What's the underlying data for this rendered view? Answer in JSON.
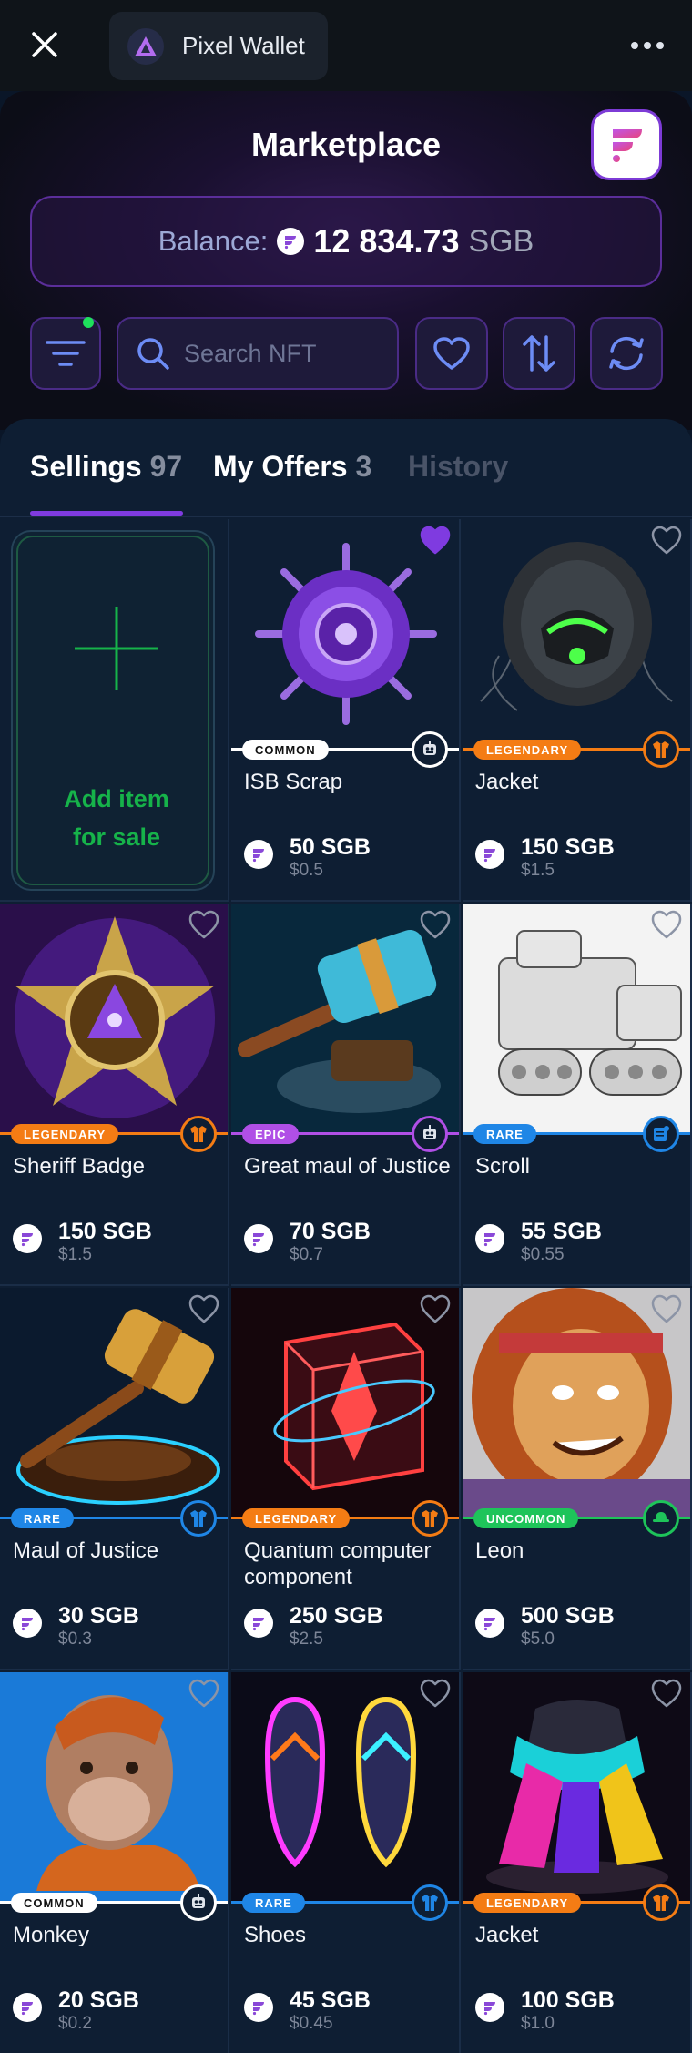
{
  "topbar": {
    "wallet_name": "Pixel Wallet"
  },
  "header": {
    "title": "Marketplace",
    "balance_label": "Balance:",
    "balance_amount": "12 834.73",
    "balance_unit": "SGB"
  },
  "search": {
    "placeholder": "Search NFT"
  },
  "tabs": [
    {
      "label": "Sellings",
      "count": "97",
      "active": true
    },
    {
      "label": "My Offers",
      "count": "3",
      "active": false
    },
    {
      "label": "History",
      "count": "",
      "active": false
    }
  ],
  "add_item": {
    "line1": "Add item",
    "line2": "for sale"
  },
  "colors": {
    "common": "#ffffff",
    "legendary": "#f47c14",
    "epic": "#b04fe6",
    "rare": "#1f86e6",
    "uncommon": "#1ec45a",
    "accent": "#7f3be0"
  },
  "items": [
    {
      "name": "ISB Scrap",
      "rarity": "COMMON",
      "price": "50 SGB",
      "usd": "$0.5",
      "liked": true,
      "icon": "robot-icon"
    },
    {
      "name": "Jacket",
      "rarity": "LEGENDARY",
      "price": "150 SGB",
      "usd": "$1.5",
      "liked": false,
      "icon": "jacket-icon"
    },
    {
      "name": "Sheriff Badge",
      "rarity": "LEGENDARY",
      "price": "150 SGB",
      "usd": "$1.5",
      "liked": false,
      "icon": "jacket-icon"
    },
    {
      "name": "Great maul of Justice",
      "rarity": "EPIC",
      "price": "70 SGB",
      "usd": "$0.7",
      "liked": false,
      "icon": "robot-icon"
    },
    {
      "name": "Scroll",
      "rarity": "RARE",
      "price": "55 SGB",
      "usd": "$0.55",
      "liked": false,
      "icon": "scroll-icon"
    },
    {
      "name": "Maul of Justice",
      "rarity": "RARE",
      "price": "30 SGB",
      "usd": "$0.3",
      "liked": false,
      "icon": "jacket-icon"
    },
    {
      "name": "Quantum computer component",
      "rarity": "LEGENDARY",
      "price": "250 SGB",
      "usd": "$2.5",
      "liked": false,
      "icon": "jacket-icon"
    },
    {
      "name": "Leon",
      "rarity": "UNCOMMON",
      "price": "500 SGB",
      "usd": "$5.0",
      "liked": false,
      "icon": "hat-icon"
    },
    {
      "name": "Monkey",
      "rarity": "COMMON",
      "price": "20 SGB",
      "usd": "$0.2",
      "liked": false,
      "icon": "robot-icon"
    },
    {
      "name": "Shoes",
      "rarity": "RARE",
      "price": "45 SGB",
      "usd": "$0.45",
      "liked": false,
      "icon": "jacket-icon"
    },
    {
      "name": "Jacket",
      "rarity": "LEGENDARY",
      "price": "100 SGB",
      "usd": "$1.0",
      "liked": false,
      "icon": "jacket-icon"
    }
  ]
}
